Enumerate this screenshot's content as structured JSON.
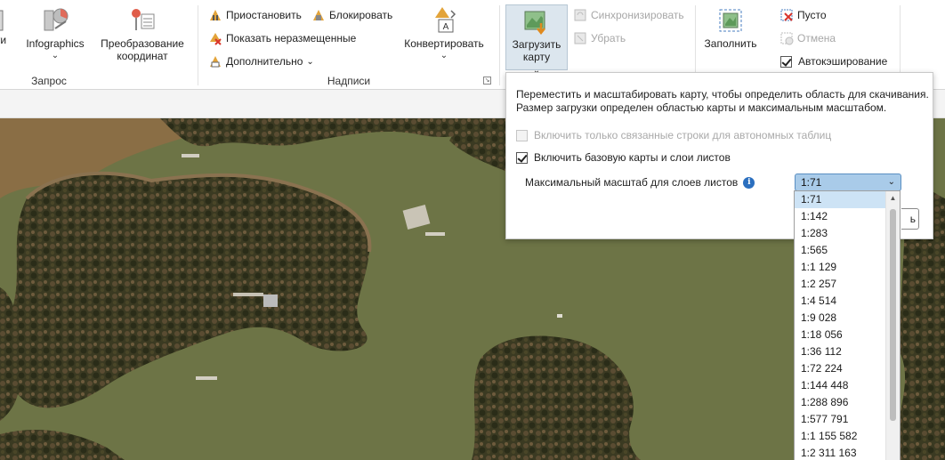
{
  "ribbon": {
    "query_group": {
      "title": "Запрос",
      "partial_label": "ти",
      "infographics_label": "Infographics",
      "convert_coords_label": "Преобразование координат"
    },
    "labels_group": {
      "title": "Надписи",
      "pause_label": "Приостановить",
      "lock_label": "Блокировать",
      "show_unplaced_label": "Показать неразмещенные",
      "more_label": "Дополнительно",
      "convert_label": "Конвертировать"
    },
    "offline_group": {
      "load_map_label": "Загрузить карту",
      "sync_label": "Синхронизировать",
      "remove_label": "Убрать"
    },
    "fill_group": {
      "fill_label": "Заполнить",
      "empty_label": "Пусто",
      "cancel_label": "Отмена",
      "autocache_label": "Автокэширование"
    }
  },
  "panel": {
    "description": "Переместить и масштабировать карту, чтобы определить область для скачивания. Размер загрузки определен областью карты и максимальным масштабом.",
    "opt_related_rows": "Включить только связанные строки для автономных таблиц",
    "opt_basemap": "Включить базовую карты и слои  листов",
    "max_scale_label": "Максимальный масштаб для слоев листов",
    "selected_scale": "1:71",
    "hidden_button_partial": "ь"
  },
  "scale_options": [
    "1:71",
    "1:142",
    "1:283",
    "1:565",
    "1:1 129",
    "1:2 257",
    "1:4 514",
    "1:9 028",
    "1:18 056",
    "1:36 112",
    "1:72 224",
    "1:144 448",
    "1:288 896",
    "1:577 791",
    "1:1 155 582",
    "1:2 311 163"
  ],
  "colors": {
    "accent": "#2b6fbf",
    "selected_bg": "#a9cbe9",
    "water": "#6d7446",
    "shore": "#8a6e45",
    "forest": "#3b3a22"
  }
}
